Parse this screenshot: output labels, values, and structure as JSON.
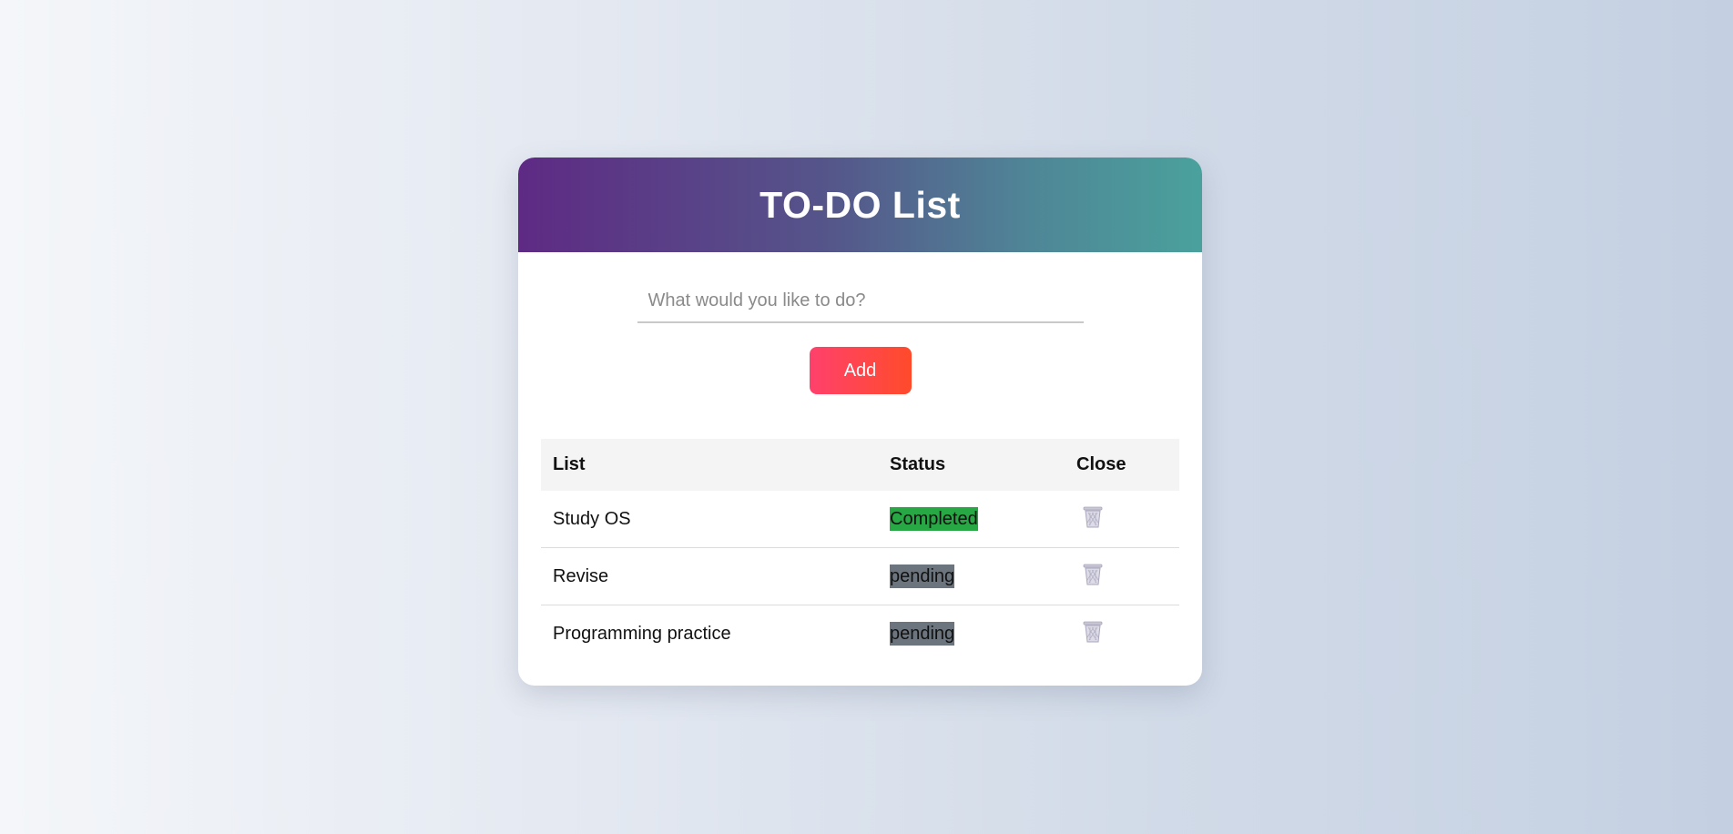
{
  "app": {
    "title": "TO-DO List"
  },
  "input": {
    "placeholder": "What would you like to do?",
    "value": ""
  },
  "add_button": {
    "label": "Add"
  },
  "table": {
    "headers": {
      "list": "List",
      "status": "Status",
      "close": "Close"
    },
    "rows": [
      {
        "task": "Study OS",
        "status": "Completed",
        "status_color": "#28a745"
      },
      {
        "task": "Revise",
        "status": "pending",
        "status_color": "#6c757d"
      },
      {
        "task": "Programming practice",
        "status": "pending",
        "status_color": "#6c757d"
      }
    ]
  },
  "icons": {
    "delete": "trash-icon"
  },
  "colors": {
    "header_gradient_start": "#5e2a84",
    "header_gradient_end": "#4aa19c",
    "add_button_start": "#ff416c",
    "add_button_end": "#ff4b2b"
  }
}
